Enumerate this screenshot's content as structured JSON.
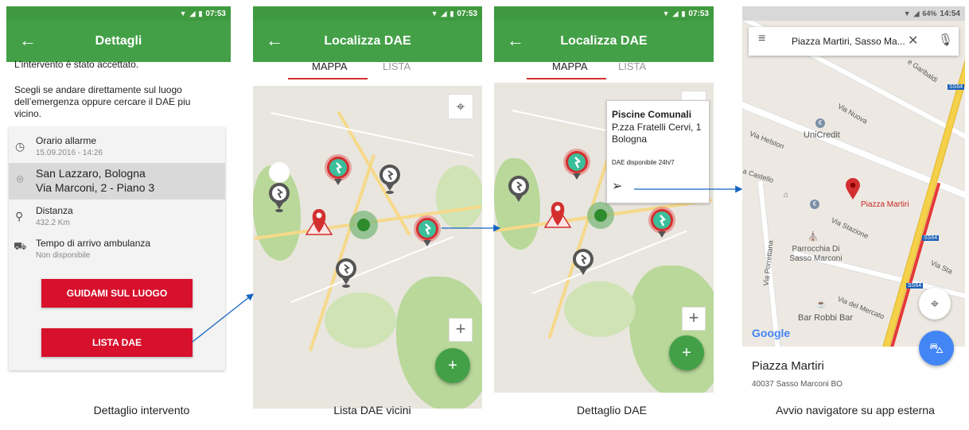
{
  "status_bar": {
    "time_1": "07:53",
    "time_2": "07:53",
    "time_3": "07:53",
    "time_4": "14:54",
    "battery_4": "64%"
  },
  "screen1": {
    "title": "Dettagli",
    "intro_1": "L’intervento è stato accettato.",
    "intro_2": "Scegli se andare direttamente sul luogo dell’emergenza oppure cercare il DAE piu vicino.",
    "alarm_label": "Orario allarme",
    "alarm_value": "15.09.2016 - 14:26",
    "address_line1": "San Lazzaro, Bologna",
    "address_line2": "Via Marconi, 2 - Piano 3",
    "distance_label": "Distanza",
    "distance_value": "432.2 Km",
    "eta_label": "Tempo di arrivo ambulanza",
    "eta_value": "Non disponibile",
    "btn_guide": "GUIDAMI SUL LUOGO",
    "btn_list": "LISTA DAE"
  },
  "screen2": {
    "title": "Localizza DAE",
    "tab_map": "MAPPA",
    "tab_list": "LISTA"
  },
  "screen3": {
    "title": "Localizza DAE",
    "tab_map": "MAPPA",
    "tab_list": "LISTA",
    "popup_title": "Piscine Comunali",
    "popup_line1": "P.zza Fratelli Cervi, 1",
    "popup_line2": "Bologna",
    "popup_avail": "DAE disponibile 24h/7"
  },
  "screen4": {
    "search_value": "Piazza Martiri, Sasso Ma...",
    "place_name": "Piazza Martiri",
    "place_address": "40037 Sasso Marconi BO",
    "map_labels": {
      "pin": "Piazza Martiri",
      "unicredit": "UniCredit",
      "parrocchia": "Parrocchia Di Sasso Marconi",
      "bar": "Bar Robbi Bar",
      "via_nuova": "Via Nuova",
      "via_helston": "Via Helston",
      "via_castello": "a Castello",
      "via_stazione": "Via Stazione",
      "via_porrettana": "Via Porrettana",
      "via_mercato": "Via del Mercato",
      "via_stazione2": "Via Sta",
      "via_garibaldi": "e Garibaldi",
      "ss64a": "SS64",
      "ss64b": "SS64",
      "ss64c": "SS64",
      "google": "Google"
    }
  },
  "captions": {
    "c1": "Dettaglio intervento",
    "c2": "Lista DAE vicini",
    "c3": "Dettaglio DAE",
    "c4": "Avvio navigatore su app esterna"
  },
  "colors": {
    "green": "#43a047",
    "red": "#d7102c",
    "aed_green": "#3bbf9a",
    "marker_gray": "#555555",
    "flow_arrow": "#1565c0"
  }
}
